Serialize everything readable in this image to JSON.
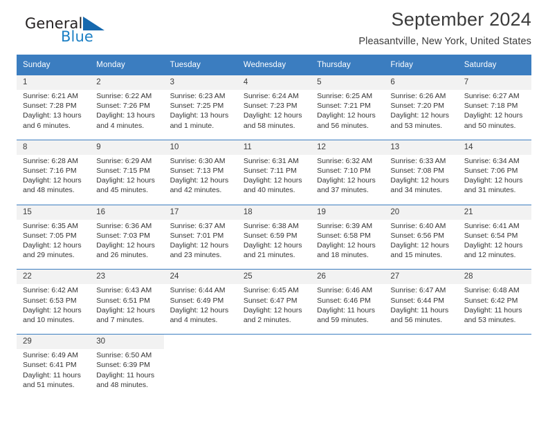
{
  "brand": {
    "name_top": "General",
    "name_bottom": "Blue",
    "color_top": "#231f20",
    "color_bottom": "#1b7fc4",
    "triangle_color": "#1668ae"
  },
  "header": {
    "title": "September 2024",
    "subtitle": "Pleasantville, New York, United States"
  },
  "theme": {
    "header_bg": "#3b7dc0",
    "header_text": "#ffffff",
    "daynum_bg": "#f2f2f2",
    "cell_bg": "#ffffff",
    "rule_color": "#3b7dc0"
  },
  "calendar": {
    "weekdays": [
      "Sunday",
      "Monday",
      "Tuesday",
      "Wednesday",
      "Thursday",
      "Friday",
      "Saturday"
    ],
    "weeks": [
      [
        {
          "day": "1",
          "sunrise": "Sunrise: 6:21 AM",
          "sunset": "Sunset: 7:28 PM",
          "daylight1": "Daylight: 13 hours",
          "daylight2": "and 6 minutes."
        },
        {
          "day": "2",
          "sunrise": "Sunrise: 6:22 AM",
          "sunset": "Sunset: 7:26 PM",
          "daylight1": "Daylight: 13 hours",
          "daylight2": "and 4 minutes."
        },
        {
          "day": "3",
          "sunrise": "Sunrise: 6:23 AM",
          "sunset": "Sunset: 7:25 PM",
          "daylight1": "Daylight: 13 hours",
          "daylight2": "and 1 minute."
        },
        {
          "day": "4",
          "sunrise": "Sunrise: 6:24 AM",
          "sunset": "Sunset: 7:23 PM",
          "daylight1": "Daylight: 12 hours",
          "daylight2": "and 58 minutes."
        },
        {
          "day": "5",
          "sunrise": "Sunrise: 6:25 AM",
          "sunset": "Sunset: 7:21 PM",
          "daylight1": "Daylight: 12 hours",
          "daylight2": "and 56 minutes."
        },
        {
          "day": "6",
          "sunrise": "Sunrise: 6:26 AM",
          "sunset": "Sunset: 7:20 PM",
          "daylight1": "Daylight: 12 hours",
          "daylight2": "and 53 minutes."
        },
        {
          "day": "7",
          "sunrise": "Sunrise: 6:27 AM",
          "sunset": "Sunset: 7:18 PM",
          "daylight1": "Daylight: 12 hours",
          "daylight2": "and 50 minutes."
        }
      ],
      [
        {
          "day": "8",
          "sunrise": "Sunrise: 6:28 AM",
          "sunset": "Sunset: 7:16 PM",
          "daylight1": "Daylight: 12 hours",
          "daylight2": "and 48 minutes."
        },
        {
          "day": "9",
          "sunrise": "Sunrise: 6:29 AM",
          "sunset": "Sunset: 7:15 PM",
          "daylight1": "Daylight: 12 hours",
          "daylight2": "and 45 minutes."
        },
        {
          "day": "10",
          "sunrise": "Sunrise: 6:30 AM",
          "sunset": "Sunset: 7:13 PM",
          "daylight1": "Daylight: 12 hours",
          "daylight2": "and 42 minutes."
        },
        {
          "day": "11",
          "sunrise": "Sunrise: 6:31 AM",
          "sunset": "Sunset: 7:11 PM",
          "daylight1": "Daylight: 12 hours",
          "daylight2": "and 40 minutes."
        },
        {
          "day": "12",
          "sunrise": "Sunrise: 6:32 AM",
          "sunset": "Sunset: 7:10 PM",
          "daylight1": "Daylight: 12 hours",
          "daylight2": "and 37 minutes."
        },
        {
          "day": "13",
          "sunrise": "Sunrise: 6:33 AM",
          "sunset": "Sunset: 7:08 PM",
          "daylight1": "Daylight: 12 hours",
          "daylight2": "and 34 minutes."
        },
        {
          "day": "14",
          "sunrise": "Sunrise: 6:34 AM",
          "sunset": "Sunset: 7:06 PM",
          "daylight1": "Daylight: 12 hours",
          "daylight2": "and 31 minutes."
        }
      ],
      [
        {
          "day": "15",
          "sunrise": "Sunrise: 6:35 AM",
          "sunset": "Sunset: 7:05 PM",
          "daylight1": "Daylight: 12 hours",
          "daylight2": "and 29 minutes."
        },
        {
          "day": "16",
          "sunrise": "Sunrise: 6:36 AM",
          "sunset": "Sunset: 7:03 PM",
          "daylight1": "Daylight: 12 hours",
          "daylight2": "and 26 minutes."
        },
        {
          "day": "17",
          "sunrise": "Sunrise: 6:37 AM",
          "sunset": "Sunset: 7:01 PM",
          "daylight1": "Daylight: 12 hours",
          "daylight2": "and 23 minutes."
        },
        {
          "day": "18",
          "sunrise": "Sunrise: 6:38 AM",
          "sunset": "Sunset: 6:59 PM",
          "daylight1": "Daylight: 12 hours",
          "daylight2": "and 21 minutes."
        },
        {
          "day": "19",
          "sunrise": "Sunrise: 6:39 AM",
          "sunset": "Sunset: 6:58 PM",
          "daylight1": "Daylight: 12 hours",
          "daylight2": "and 18 minutes."
        },
        {
          "day": "20",
          "sunrise": "Sunrise: 6:40 AM",
          "sunset": "Sunset: 6:56 PM",
          "daylight1": "Daylight: 12 hours",
          "daylight2": "and 15 minutes."
        },
        {
          "day": "21",
          "sunrise": "Sunrise: 6:41 AM",
          "sunset": "Sunset: 6:54 PM",
          "daylight1": "Daylight: 12 hours",
          "daylight2": "and 12 minutes."
        }
      ],
      [
        {
          "day": "22",
          "sunrise": "Sunrise: 6:42 AM",
          "sunset": "Sunset: 6:53 PM",
          "daylight1": "Daylight: 12 hours",
          "daylight2": "and 10 minutes."
        },
        {
          "day": "23",
          "sunrise": "Sunrise: 6:43 AM",
          "sunset": "Sunset: 6:51 PM",
          "daylight1": "Daylight: 12 hours",
          "daylight2": "and 7 minutes."
        },
        {
          "day": "24",
          "sunrise": "Sunrise: 6:44 AM",
          "sunset": "Sunset: 6:49 PM",
          "daylight1": "Daylight: 12 hours",
          "daylight2": "and 4 minutes."
        },
        {
          "day": "25",
          "sunrise": "Sunrise: 6:45 AM",
          "sunset": "Sunset: 6:47 PM",
          "daylight1": "Daylight: 12 hours",
          "daylight2": "and 2 minutes."
        },
        {
          "day": "26",
          "sunrise": "Sunrise: 6:46 AM",
          "sunset": "Sunset: 6:46 PM",
          "daylight1": "Daylight: 11 hours",
          "daylight2": "and 59 minutes."
        },
        {
          "day": "27",
          "sunrise": "Sunrise: 6:47 AM",
          "sunset": "Sunset: 6:44 PM",
          "daylight1": "Daylight: 11 hours",
          "daylight2": "and 56 minutes."
        },
        {
          "day": "28",
          "sunrise": "Sunrise: 6:48 AM",
          "sunset": "Sunset: 6:42 PM",
          "daylight1": "Daylight: 11 hours",
          "daylight2": "and 53 minutes."
        }
      ],
      [
        {
          "day": "29",
          "sunrise": "Sunrise: 6:49 AM",
          "sunset": "Sunset: 6:41 PM",
          "daylight1": "Daylight: 11 hours",
          "daylight2": "and 51 minutes."
        },
        {
          "day": "30",
          "sunrise": "Sunrise: 6:50 AM",
          "sunset": "Sunset: 6:39 PM",
          "daylight1": "Daylight: 11 hours",
          "daylight2": "and 48 minutes."
        },
        {
          "day": "",
          "sunrise": "",
          "sunset": "",
          "daylight1": "",
          "daylight2": ""
        },
        {
          "day": "",
          "sunrise": "",
          "sunset": "",
          "daylight1": "",
          "daylight2": ""
        },
        {
          "day": "",
          "sunrise": "",
          "sunset": "",
          "daylight1": "",
          "daylight2": ""
        },
        {
          "day": "",
          "sunrise": "",
          "sunset": "",
          "daylight1": "",
          "daylight2": ""
        },
        {
          "day": "",
          "sunrise": "",
          "sunset": "",
          "daylight1": "",
          "daylight2": ""
        }
      ]
    ]
  }
}
